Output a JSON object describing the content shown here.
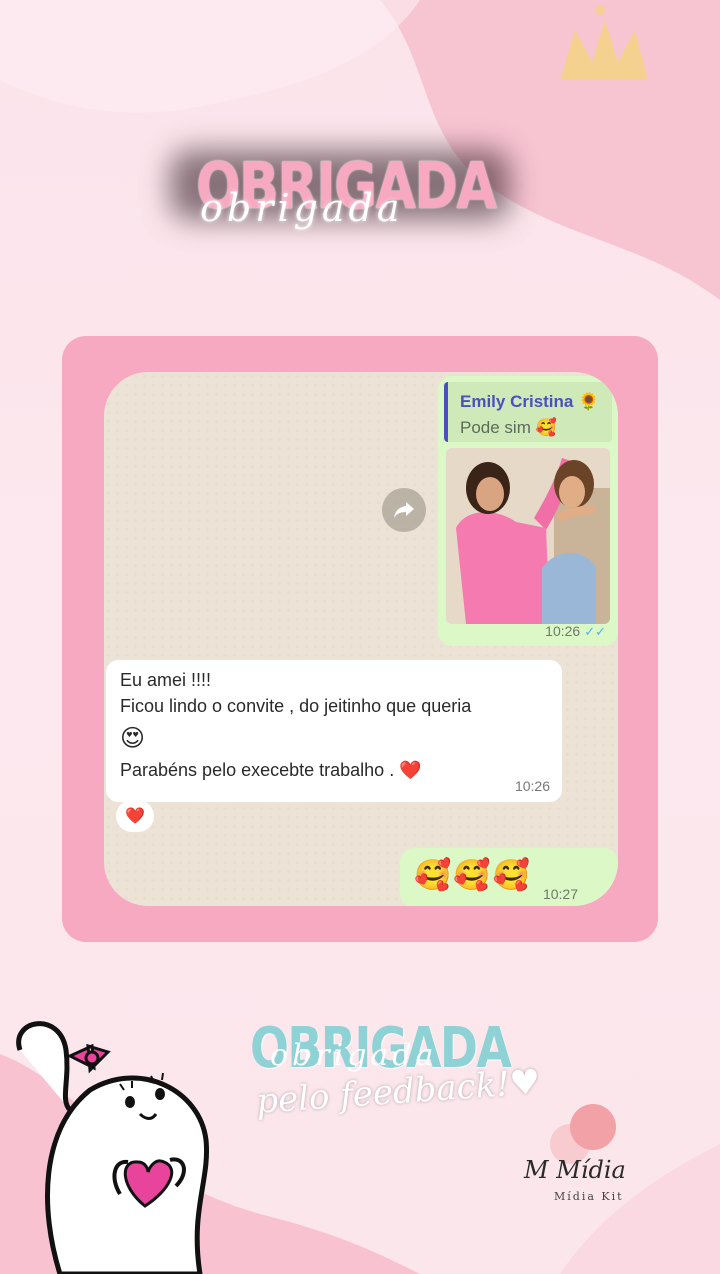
{
  "header": {
    "title": "OBRIGADA",
    "script_overlay": "obrigada"
  },
  "chat": {
    "outgoing_image": {
      "reply_name": "Emily Cristina 🌻",
      "reply_text": "Pode sim 🥰",
      "time": "10:26",
      "ticks": "✓✓"
    },
    "incoming": {
      "lines": [
        "Eu amei !!!!",
        "Ficou lindo o convite , do jeitinho que queria",
        "😍",
        "Parabéns pelo execebte trabalho . ❤️"
      ],
      "time": "10:26",
      "reaction": "❤️"
    },
    "outgoing_emoji": {
      "emojis": [
        "🥰",
        "🥰",
        "🥰"
      ],
      "time": "10:27"
    }
  },
  "footer": {
    "title": "OBRIGADA",
    "script_overlay": "obrigada",
    "subtitle": "pelo feedback!♥",
    "brand_logo": "M Mídia",
    "brand_tag": "Mídia Kit"
  },
  "colors": {
    "frame_pink": "#f6a9c0",
    "chat_bg": "#ece3d6",
    "out_bubble": "#dcf8c6",
    "reply_name": "#4b4fc2",
    "title_teal": "#8fd2d6"
  }
}
